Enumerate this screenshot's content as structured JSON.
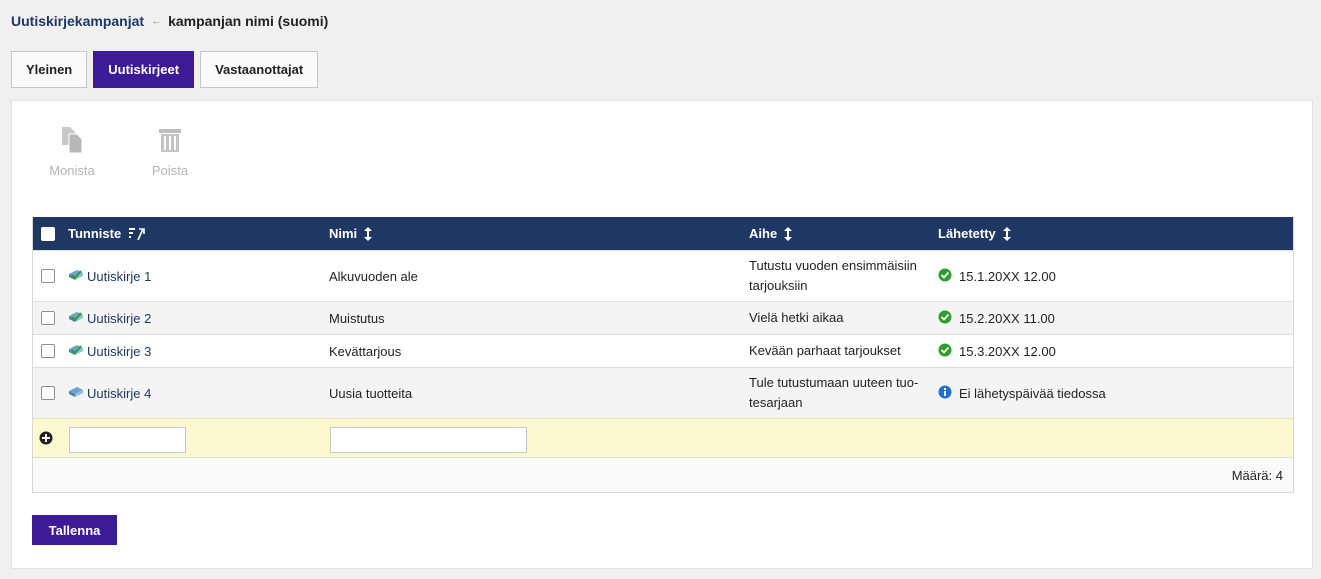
{
  "breadcrumb": {
    "parent": "Uutiskirjekampanjat",
    "separator": "←",
    "current": "kampanjan nimi (suomi)"
  },
  "tabs": [
    {
      "label": "Yleinen",
      "active": false
    },
    {
      "label": "Uutiskirjeet",
      "active": true
    },
    {
      "label": "Vastaanottajat",
      "active": false
    }
  ],
  "toolbar": {
    "duplicate_label": "Monista",
    "delete_label": "Poista"
  },
  "table": {
    "columns": {
      "id": "Tunniste",
      "name": "Nimi",
      "subject": "Aihe",
      "sent": "Lähetetty"
    },
    "rows": [
      {
        "id": "Uutiskirje 1",
        "name": "Alkuvuoden ale",
        "subject_line1": "Tutustu vuoden ensimmäisiin",
        "subject_line2": "tarjouksiin",
        "sent": "15.1.20XX 12.00",
        "status": "sent"
      },
      {
        "id": "Uutiskirje 2",
        "name": "Muistutus",
        "subject_line1": "Vielä hetki aikaa",
        "subject_line2": "",
        "sent": "15.2.20XX 11.00",
        "status": "sent"
      },
      {
        "id": "Uutiskirje 3",
        "name": "Kevättarjous",
        "subject_line1": "Kevään parhaat tarjoukset",
        "subject_line2": "",
        "sent": "15.3.20XX 12.00",
        "status": "sent"
      },
      {
        "id": "Uutiskirje 4",
        "name": "Uusia tuotteita",
        "subject_line1": "Tule tutustumaan uuteen tuo-",
        "subject_line2": "tesarjaan",
        "sent": "Ei lähetyspäivää tiedossa",
        "status": "unknown"
      }
    ],
    "new_row": {
      "id_value": "",
      "name_value": ""
    },
    "count_text": "Määrä: 4"
  },
  "save_label": "Tallenna",
  "colors": {
    "header_bg": "#1e3763",
    "accent": "#3d1a96",
    "new_row_bg": "#fdf8cf",
    "status_ok": "#2e9e2e",
    "status_info": "#1f6fd1"
  }
}
